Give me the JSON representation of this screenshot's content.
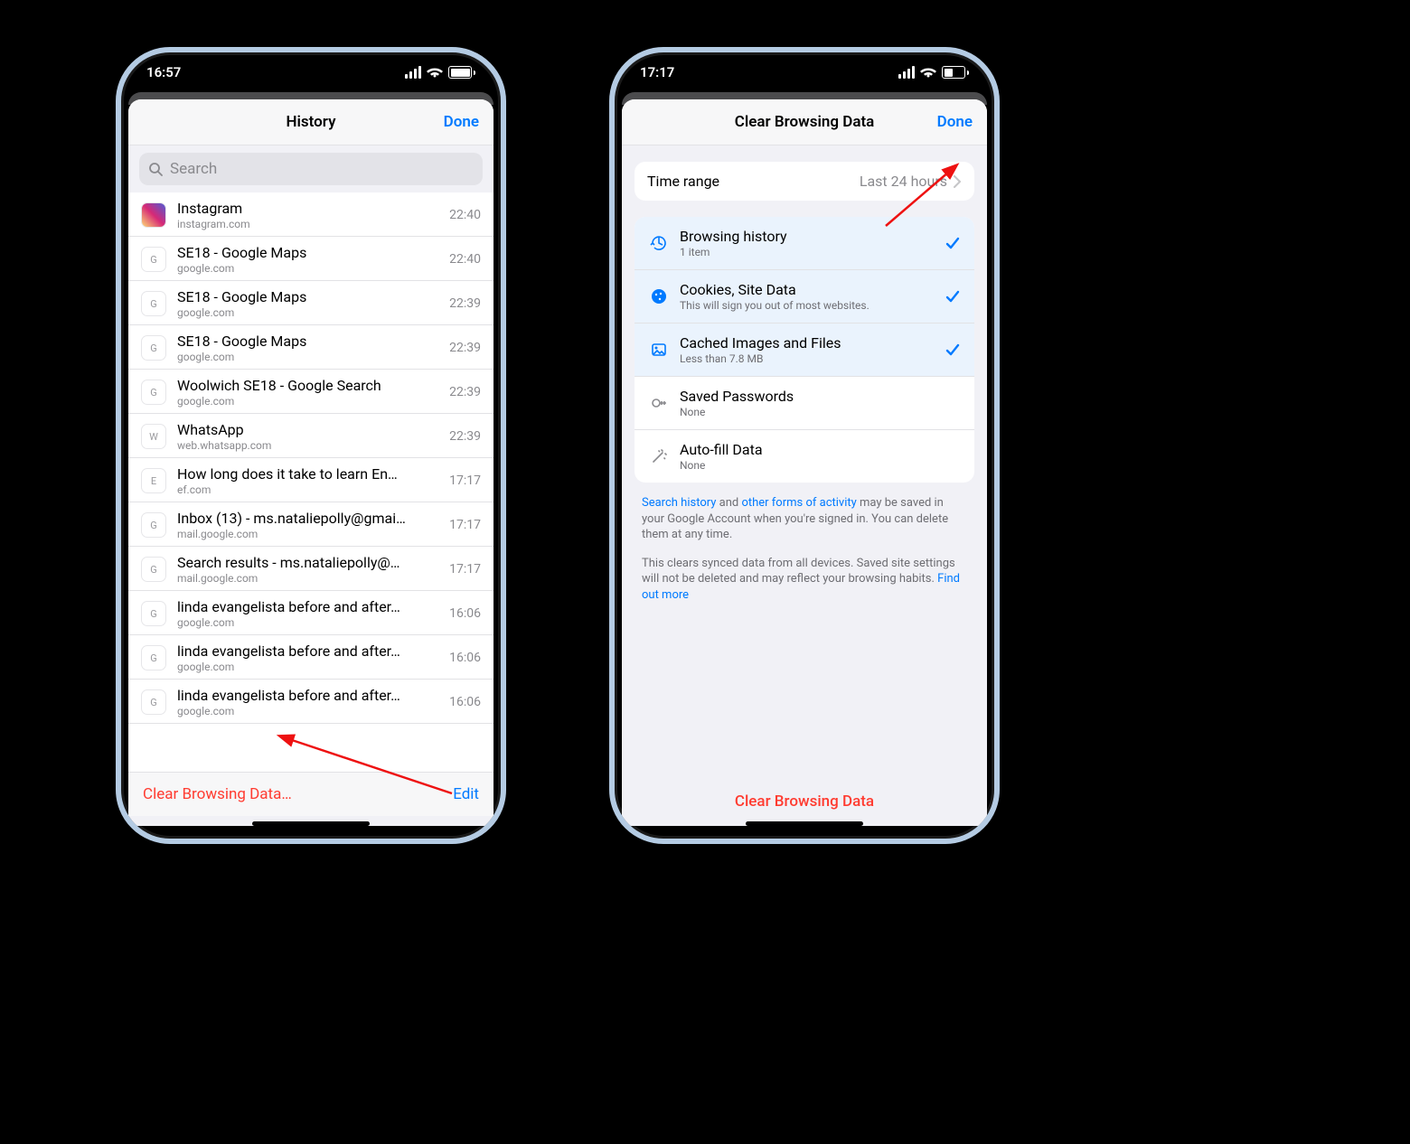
{
  "left": {
    "status_time": "16:57",
    "battery_pct": 90,
    "nav": {
      "title": "History",
      "done": "Done"
    },
    "search_placeholder": "Search",
    "rows": [
      {
        "icon": "insta",
        "letter": "",
        "title": "Instagram",
        "sub": "instagram.com",
        "time": "22:40"
      },
      {
        "icon": "g",
        "letter": "G",
        "title": "SE18 - Google Maps",
        "sub": "google.com",
        "time": "22:40"
      },
      {
        "icon": "g",
        "letter": "G",
        "title": "SE18 - Google Maps",
        "sub": "google.com",
        "time": "22:39"
      },
      {
        "icon": "g",
        "letter": "G",
        "title": "SE18 - Google Maps",
        "sub": "google.com",
        "time": "22:39"
      },
      {
        "icon": "g",
        "letter": "G",
        "title": "Woolwich SE18 - Google Search",
        "sub": "google.com",
        "time": "22:39"
      },
      {
        "icon": "w",
        "letter": "W",
        "title": "WhatsApp",
        "sub": "web.whatsapp.com",
        "time": "22:39"
      },
      {
        "icon": "e",
        "letter": "E",
        "title": "How long does it take to learn En…",
        "sub": "ef.com",
        "time": "17:17"
      },
      {
        "icon": "g",
        "letter": "G",
        "title": "Inbox (13) - ms.nataliepolly@gmai…",
        "sub": "mail.google.com",
        "time": "17:17"
      },
      {
        "icon": "g",
        "letter": "G",
        "title": "Search results - ms.nataliepolly@…",
        "sub": "mail.google.com",
        "time": "17:17"
      },
      {
        "icon": "g",
        "letter": "G",
        "title": "linda evangelista before and after…",
        "sub": "google.com",
        "time": "16:06"
      },
      {
        "icon": "g",
        "letter": "G",
        "title": "linda evangelista before and after…",
        "sub": "google.com",
        "time": "16:06"
      },
      {
        "icon": "g",
        "letter": "G",
        "title": "linda evangelista before and after…",
        "sub": "google.com",
        "time": "16:06"
      }
    ],
    "toolbar": {
      "clear": "Clear Browsing Data…",
      "edit": "Edit"
    }
  },
  "right": {
    "status_time": "17:17",
    "battery_pct": 40,
    "nav": {
      "title": "Clear Browsing Data",
      "done": "Done"
    },
    "time_range": {
      "label": "Time range",
      "value": "Last 24 hours"
    },
    "options": [
      {
        "icon": "history",
        "title": "Browsing history",
        "sub": "1 item",
        "checked": true,
        "selected": true
      },
      {
        "icon": "cookie",
        "title": "Cookies, Site Data",
        "sub": "This will sign you out of most websites.",
        "checked": true,
        "selected": true
      },
      {
        "icon": "image",
        "title": "Cached Images and Files",
        "sub": "Less than 7.8 MB",
        "checked": true,
        "selected": true
      },
      {
        "icon": "key",
        "title": "Saved Passwords",
        "sub": "None",
        "checked": false,
        "selected": false
      },
      {
        "icon": "wand",
        "title": "Auto-fill Data",
        "sub": "None",
        "checked": false,
        "selected": false
      }
    ],
    "note1": {
      "link1": "Search history",
      "text1": " and ",
      "link2": "other forms of activity",
      "text2": " may be saved in your Google Account when you're signed in. You can delete them at any time."
    },
    "note2": {
      "text": "This clears synced data from all devices. Saved site settings will not be deleted and may reflect your browsing habits. ",
      "link": "Find out more"
    },
    "button": "Clear Browsing Data"
  }
}
